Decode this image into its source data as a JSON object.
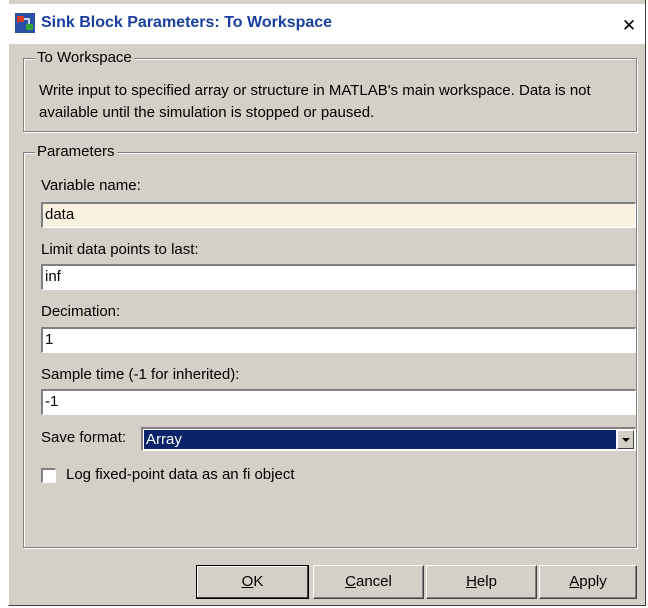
{
  "window": {
    "title": "Sink Block Parameters: To Workspace"
  },
  "block_group": {
    "label": "To Workspace",
    "description": "Write input to specified array or structure in MATLAB's main workspace. Data is not available until the simulation is stopped or paused."
  },
  "params_group": {
    "label": "Parameters"
  },
  "fields": {
    "variable_name": {
      "label": "Variable name:",
      "value": "data"
    },
    "limit_points": {
      "label": "Limit data points to last:",
      "value": "inf"
    },
    "decimation": {
      "label": "Decimation:",
      "value": "1"
    },
    "sample_time": {
      "label": "Sample time (-1 for inherited):",
      "value": "-1"
    }
  },
  "save_format": {
    "label": "Save format:",
    "selected": "Array"
  },
  "log_fixed": {
    "label": "Log fixed-point data as an fi object",
    "checked": false
  },
  "buttons": {
    "ok": {
      "hot": "O",
      "rest": "K"
    },
    "cancel": {
      "hot": "C",
      "rest": "ancel"
    },
    "help": {
      "hot": "H",
      "rest": "elp"
    },
    "apply": {
      "hot": "A",
      "rest": "pply"
    }
  },
  "colors": {
    "title_text": "#1a3f9e",
    "selection": "#0a246a",
    "edited_field": "#fbf1e1",
    "dialog_bg": "#d4d0c8"
  }
}
